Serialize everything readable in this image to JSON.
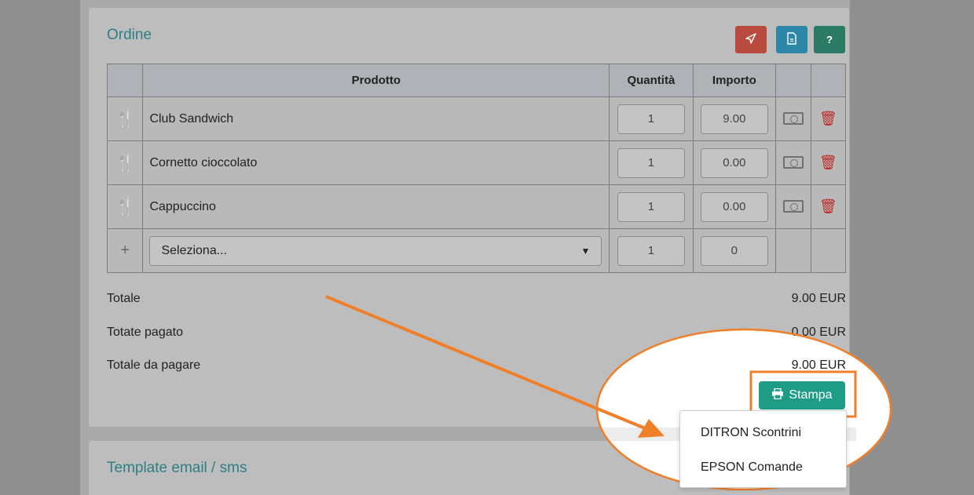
{
  "order": {
    "title": "Ordine",
    "header_buttons": [
      {
        "icon": "send-icon",
        "color": "#b94a3e"
      },
      {
        "icon": "document-icon",
        "color": "#2d88a8"
      },
      {
        "icon": "help-icon",
        "label": "?",
        "color": "#2a7a66"
      }
    ],
    "columns": [
      "Prodotto",
      "Quantità",
      "Importo"
    ],
    "rows": [
      {
        "icon": "cutlery-icon",
        "product": "Club Sandwich",
        "qty": "1",
        "amount": "9.00"
      },
      {
        "icon": "cutlery-icon",
        "product": "Cornetto cioccolato",
        "qty": "1",
        "amount": "0.00"
      },
      {
        "icon": "cutlery-icon",
        "product": "Cappuccino",
        "qty": "1",
        "amount": "0.00"
      }
    ],
    "new_row": {
      "icon": "plus-icon",
      "select_placeholder": "Seleziona...",
      "qty": "1",
      "amount": "0"
    },
    "totals": [
      {
        "label": "Totale",
        "value": "9.00 EUR"
      },
      {
        "label": "Totate pagato",
        "value": "0.00 EUR"
      },
      {
        "label": "Totale da pagare",
        "value": "9.00 EUR"
      }
    ],
    "print_button": {
      "label": "Stampa",
      "icon": "printer-icon",
      "color": "#1f9c86"
    },
    "print_menu": [
      "DITRON Scontrini",
      "EPSON Comande"
    ]
  },
  "template_section": {
    "title": "Template email / sms"
  },
  "annotation": {
    "color": "#f07f2a"
  }
}
